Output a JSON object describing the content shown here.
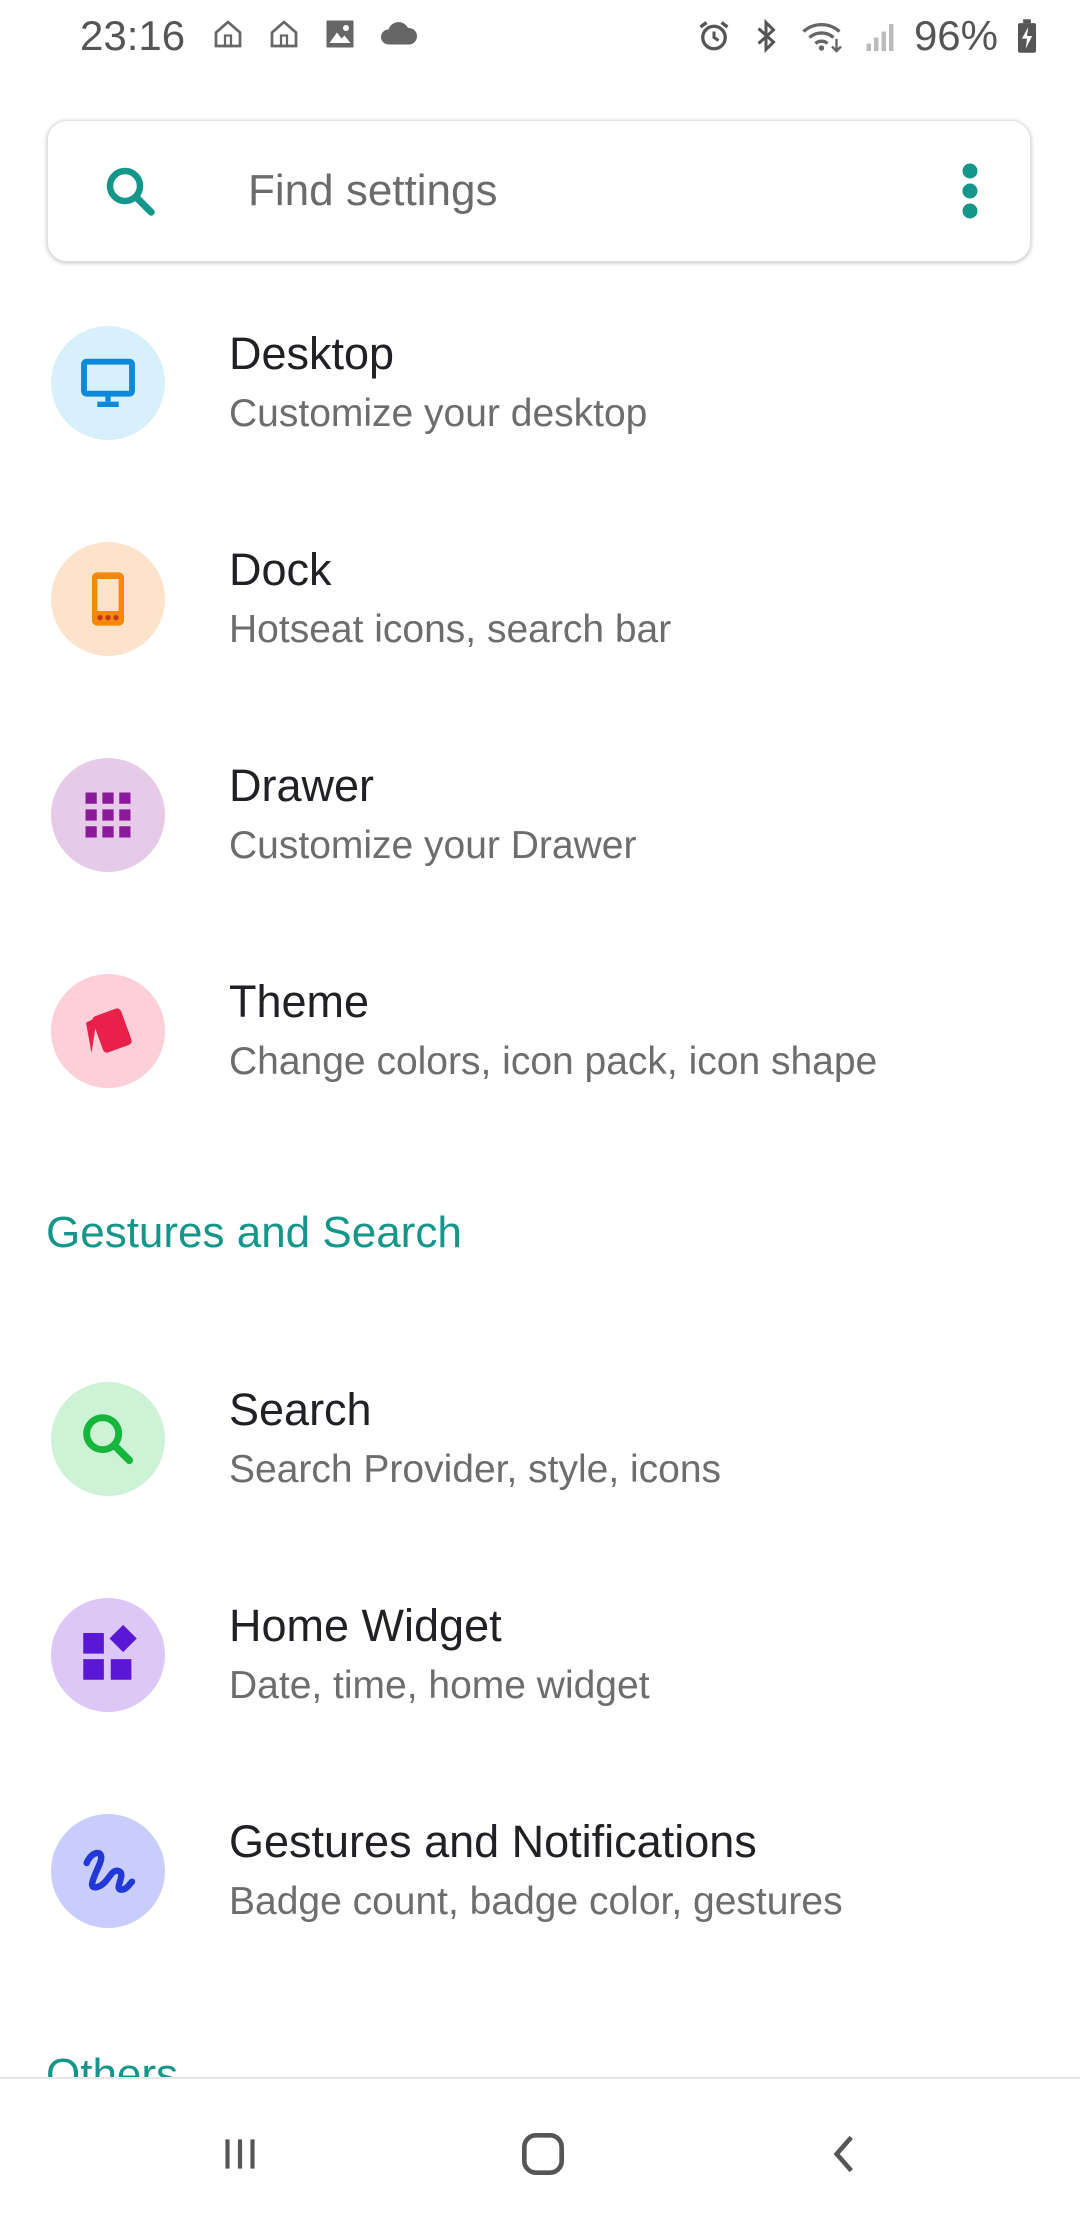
{
  "status_bar": {
    "time": "23:16",
    "battery_percent": "96%",
    "left_icons": [
      "home-icon",
      "home-icon",
      "image-icon",
      "cloud-icon"
    ],
    "right_icons": [
      "alarm-icon",
      "bluetooth-icon",
      "wifi-icon",
      "signal-icon",
      "battery-charging-icon"
    ]
  },
  "search": {
    "placeholder": "Find settings",
    "icon": "search-icon",
    "menu_icon": "more-vertical-icon",
    "accent": "#14968a"
  },
  "items": [
    {
      "title": "Desktop",
      "subtitle": "Customize your desktop",
      "icon": "monitor-icon",
      "bg": "#d8f0fb",
      "fg": "#0a8ad8"
    },
    {
      "title": "Dock",
      "subtitle": "Hotseat icons, search bar",
      "icon": "phone-dock-icon",
      "bg": "#fde3cb",
      "fg": "#f5870d"
    },
    {
      "title": "Drawer",
      "subtitle": "Customize your Drawer",
      "icon": "app-grid-icon",
      "bg": "#e6cbe8",
      "fg": "#8a1a9a"
    },
    {
      "title": "Theme",
      "subtitle": "Change colors, icon pack, icon shape",
      "icon": "palette-cards-icon",
      "bg": "#fccfd9",
      "fg": "#e8204a"
    }
  ],
  "sections": [
    {
      "header": "Gestures and Search",
      "items": [
        {
          "title": "Search",
          "subtitle": "Search Provider, style, icons",
          "icon": "search-icon",
          "bg": "#cdf2d6",
          "fg": "#16b53b"
        },
        {
          "title": "Home Widget",
          "subtitle": "Date, time, home widget",
          "icon": "widgets-icon",
          "bg": "#dcc7f7",
          "fg": "#5a18d6"
        },
        {
          "title": "Gestures and Notifications",
          "subtitle": "Badge count, badge color, gestures",
          "icon": "gesture-icon",
          "bg": "#c9cdfc",
          "fg": "#2239d8"
        }
      ]
    },
    {
      "header": "Others",
      "items": []
    }
  ],
  "nav_bar": {
    "buttons": [
      "recent-apps-icon",
      "home-button-icon",
      "back-icon"
    ]
  }
}
